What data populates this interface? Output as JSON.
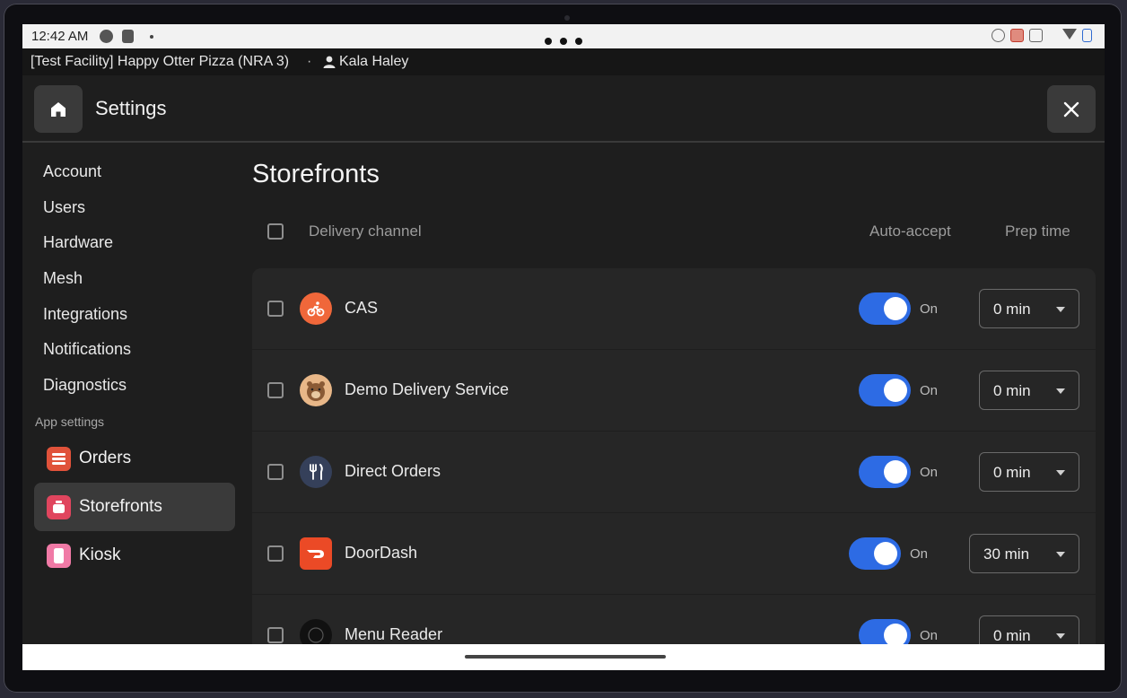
{
  "status_bar": {
    "time": "12:42 AM",
    "icons": [
      "check-circle-icon",
      "exit-icon",
      "alarm-icon",
      "cast-icon",
      "vibrate-icon",
      "signal-icon",
      "wifi-icon",
      "battery-icon"
    ]
  },
  "facility": {
    "name": "[Test Facility] Happy Otter Pizza (NRA 3)",
    "separator": "·",
    "user": "Kala Haley"
  },
  "header": {
    "title": "Settings",
    "home_icon": "home-icon",
    "close_icon": "close-icon"
  },
  "sidebar": {
    "items": [
      {
        "label": "Account"
      },
      {
        "label": "Users"
      },
      {
        "label": "Hardware"
      },
      {
        "label": "Mesh"
      },
      {
        "label": "Integrations"
      },
      {
        "label": "Notifications"
      },
      {
        "label": "Diagnostics"
      }
    ],
    "section_label": "App settings",
    "apps": [
      {
        "label": "Orders",
        "color": "#e0523a",
        "active": false
      },
      {
        "label": "Storefronts",
        "color": "#e0455e",
        "active": true
      },
      {
        "label": "Kiosk",
        "color": "#f07aa6",
        "active": false
      }
    ]
  },
  "main": {
    "title": "Storefronts",
    "columns": {
      "channel": "Delivery channel",
      "auto_accept": "Auto-accept",
      "prep_time": "Prep time"
    },
    "rows": [
      {
        "name": "CAS",
        "toggle": "On",
        "prep": "0 min",
        "logo_color": "#f0673a",
        "icon": "bike-icon"
      },
      {
        "name": "Demo Delivery Service",
        "toggle": "On",
        "prep": "0 min",
        "logo_color": "#e8b788",
        "icon": "otter-icon"
      },
      {
        "name": "Direct Orders",
        "toggle": "On",
        "prep": "0 min",
        "logo_color": "#35405a",
        "icon": "utensils-icon"
      },
      {
        "name": "DoorDash",
        "toggle": "On",
        "prep": "30 min",
        "logo_color": "#eb4a26",
        "icon": "doordash-icon"
      },
      {
        "name": "Menu Reader",
        "toggle": "On",
        "prep": "0 min",
        "logo_color": "#111111",
        "icon": "menu-reader-icon"
      }
    ]
  },
  "colors": {
    "accent": "#2d6be4",
    "background": "#1e1e1e",
    "row_background": "#262626"
  }
}
